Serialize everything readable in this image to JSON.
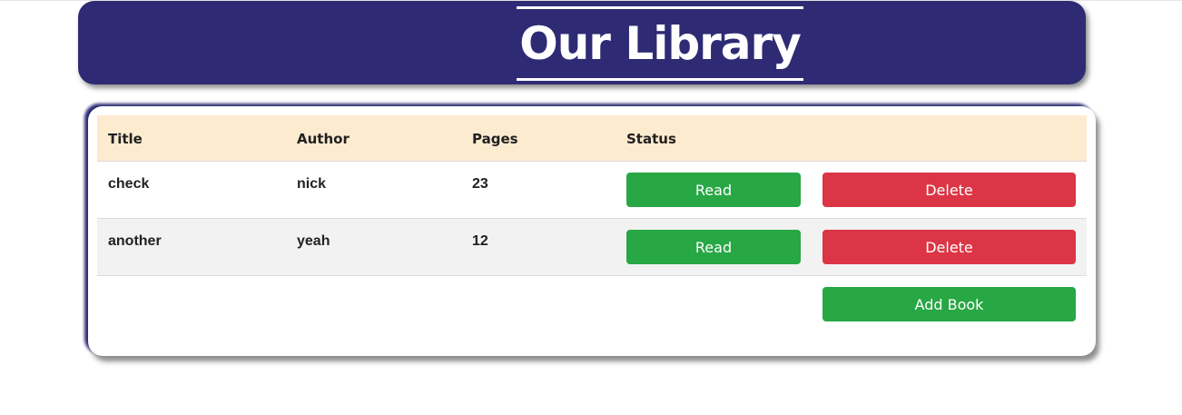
{
  "header": {
    "title": "Our Library"
  },
  "table": {
    "columns": [
      "Title",
      "Author",
      "Pages",
      "Status"
    ],
    "rows": [
      {
        "title": "check",
        "author": "nick",
        "pages": "23",
        "status_label": "Read",
        "delete_label": "Delete"
      },
      {
        "title": "another",
        "author": "yeah",
        "pages": "12",
        "status_label": "Read",
        "delete_label": "Delete"
      }
    ]
  },
  "actions": {
    "add_label": "Add Book"
  },
  "colors": {
    "header_bg": "#2e2b74",
    "table_head_bg": "#fdebd0",
    "success": "#28a745",
    "danger": "#dc3545",
    "striped_row": "#f2f2f2"
  }
}
